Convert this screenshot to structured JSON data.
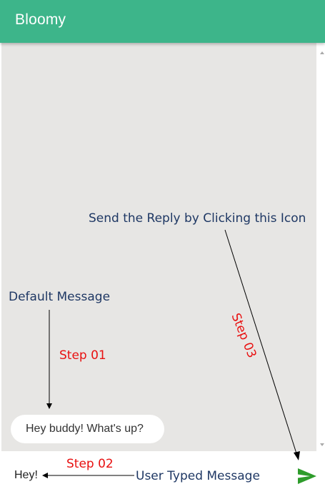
{
  "header": {
    "title": "Bloomy"
  },
  "conversation": {
    "default_message": "Hey buddy! What's up?"
  },
  "composer": {
    "typed_text": "Hey!",
    "send_icon": "send-icon"
  },
  "annotations": {
    "send_reply": "Send the Reply by Clicking this Icon",
    "default_message": "Default Message",
    "step1": "Step 01",
    "step2": "Step 02",
    "step3": "Step 03",
    "user_typed": "User Typed Message"
  },
  "colors": {
    "header_bg": "#3db58a",
    "chat_bg": "#e7e6e4",
    "send_icon": "#2e9c2b",
    "annotation_blue": "#1f3864",
    "annotation_red": "#e81010"
  }
}
